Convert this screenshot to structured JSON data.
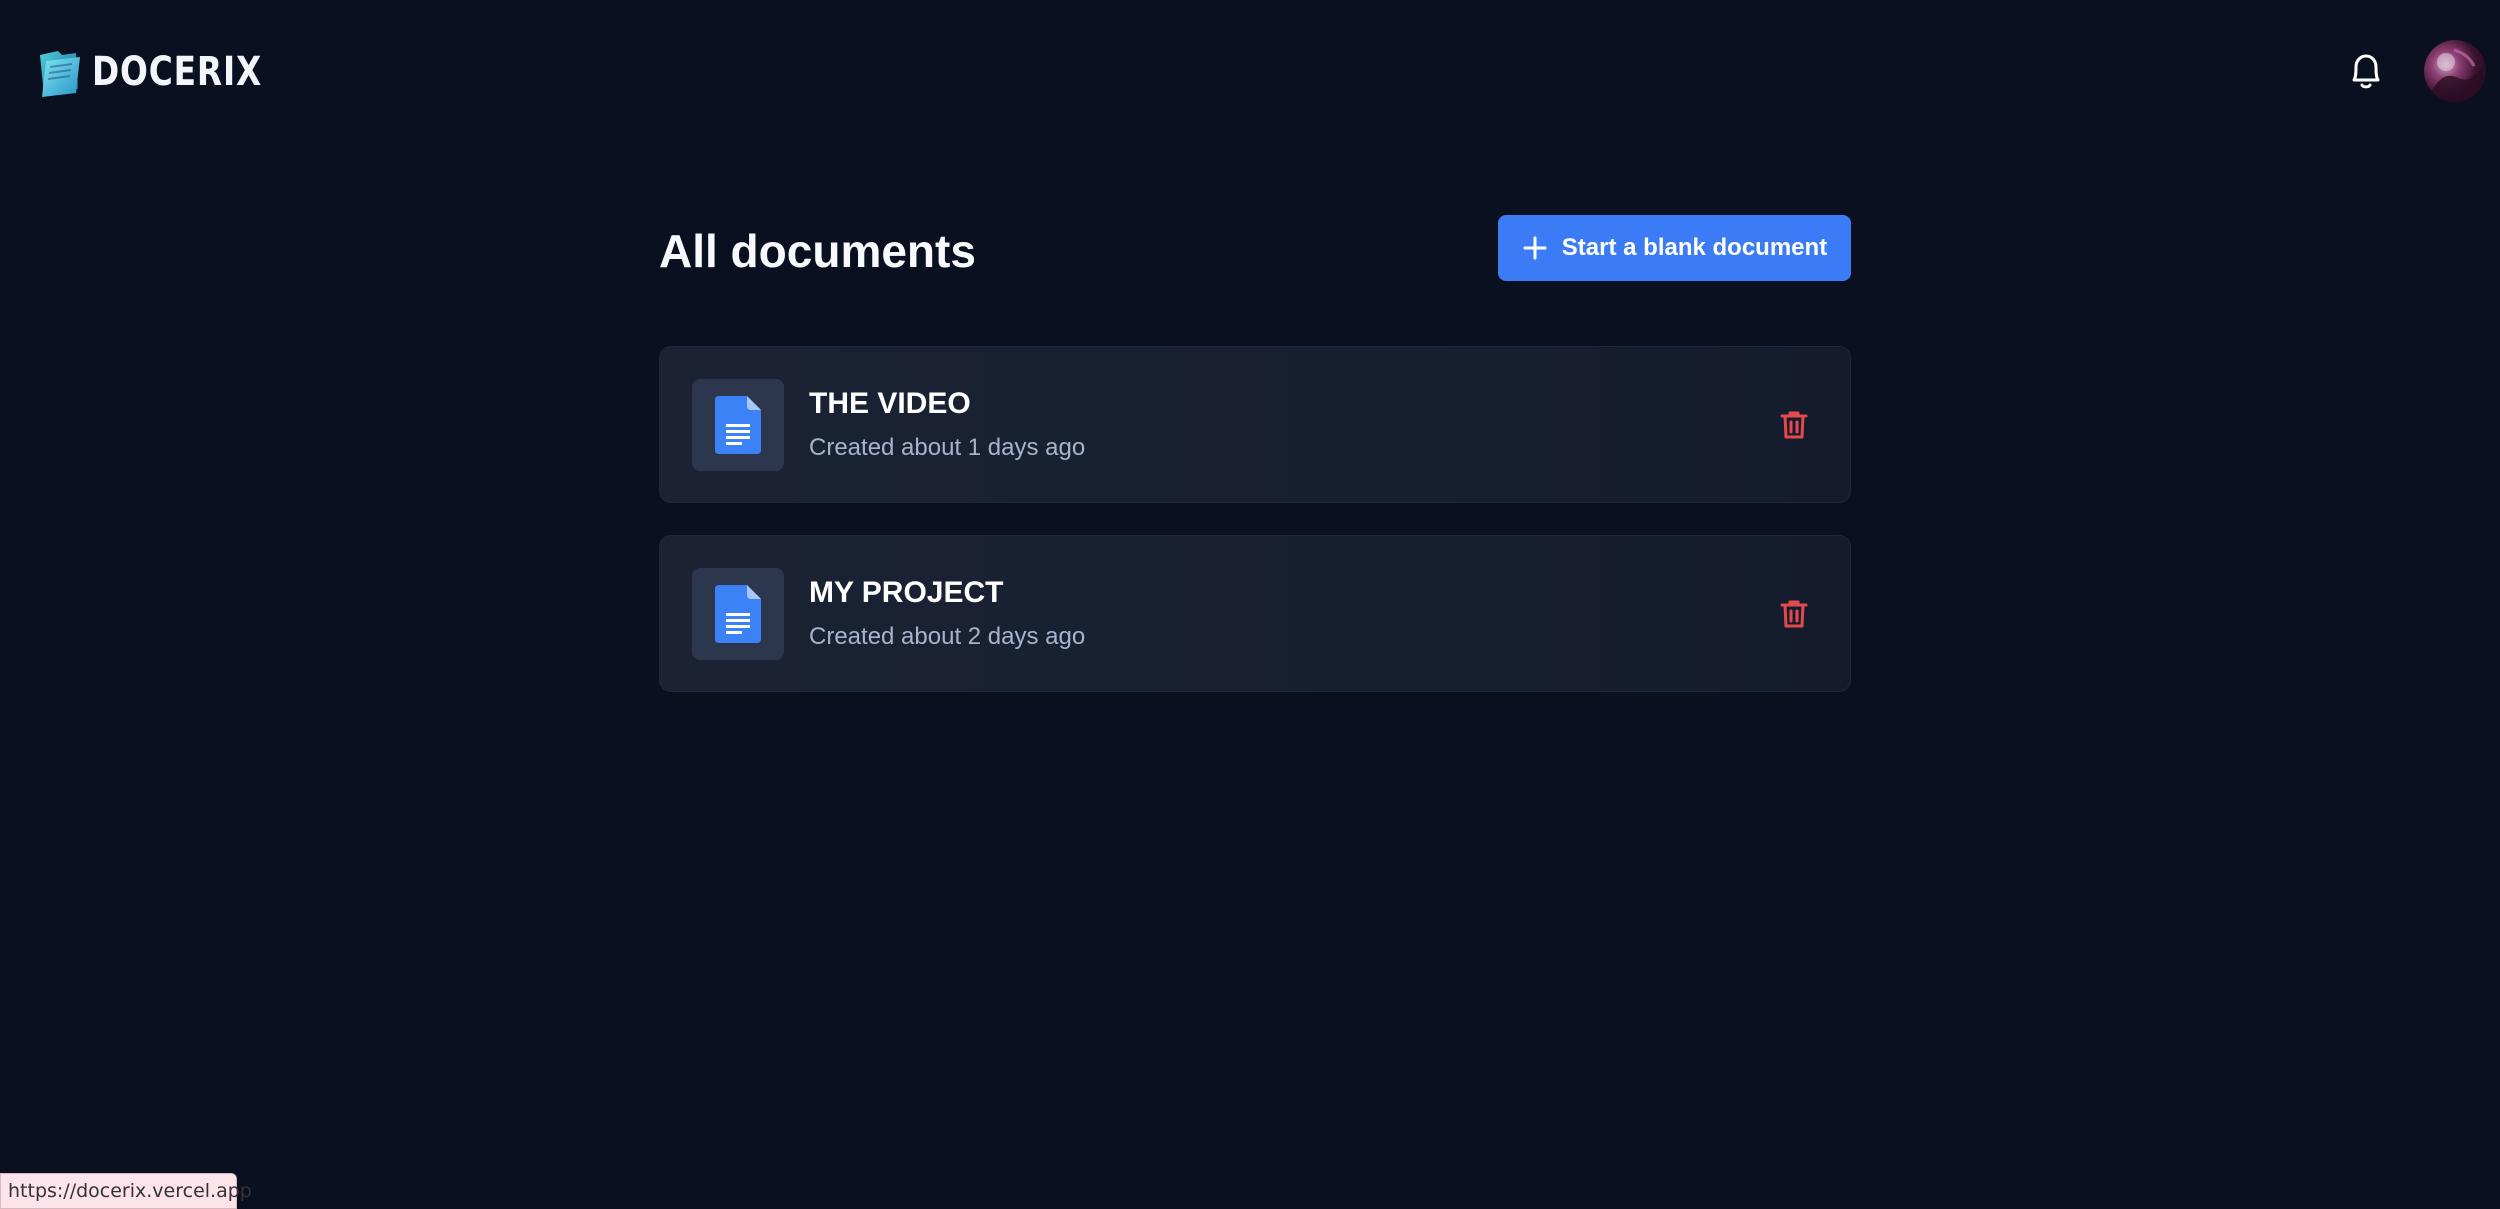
{
  "header": {
    "brand_name": "DOCERIX",
    "icons": {
      "logo": "folder-logo-icon",
      "notifications": "bell-icon",
      "profile": "user-avatar"
    }
  },
  "main": {
    "title": "All documents",
    "new_document_button": {
      "label": "Start a blank document",
      "icon": "plus-icon"
    },
    "documents": [
      {
        "title": "THE VIDEO",
        "meta": "Created about 1 days ago",
        "icon": "document-icon",
        "action_icon": "trash-icon"
      },
      {
        "title": "MY PROJECT",
        "meta": "Created about 2 days ago",
        "icon": "document-icon",
        "action_icon": "trash-icon"
      }
    ]
  },
  "status_bar": {
    "url": "https://docerix.vercel.app"
  },
  "colors": {
    "background": "#0a101f",
    "card": "#1a2234",
    "accent": "#3b7cf6",
    "danger": "#e5484d",
    "muted_text": "#a8b3cc"
  }
}
